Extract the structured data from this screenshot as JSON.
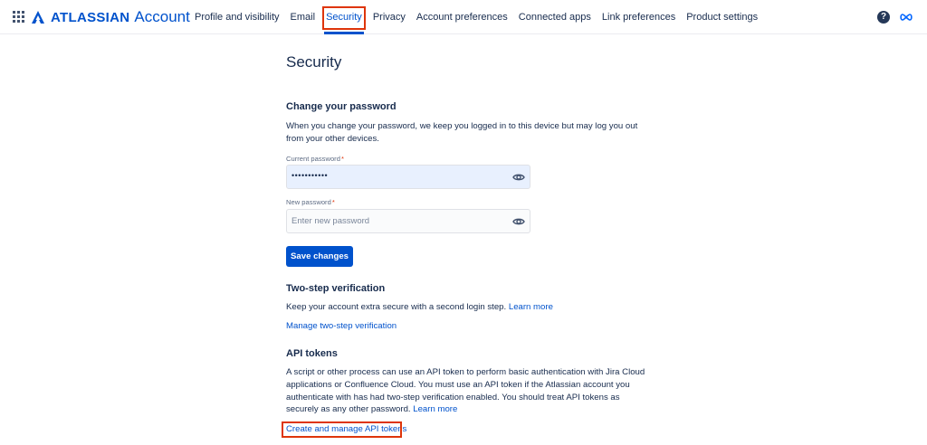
{
  "header": {
    "brand": "ATLASSIAN",
    "product": "Account",
    "nav": [
      {
        "label": "Profile and visibility"
      },
      {
        "label": "Email"
      },
      {
        "label": "Security",
        "active": true
      },
      {
        "label": "Privacy"
      },
      {
        "label": "Account preferences"
      },
      {
        "label": "Connected apps"
      },
      {
        "label": "Link preferences"
      },
      {
        "label": "Product settings"
      }
    ],
    "help_glyph": "?",
    "icons": [
      "app-switcher-icon",
      "atlassian-logo-icon",
      "help-icon",
      "infinity-icon"
    ]
  },
  "page": {
    "title": "Security",
    "password": {
      "heading": "Change your password",
      "description": "When you change your password, we keep you logged in to this device but may log you out from your other devices.",
      "current_label": "Current password",
      "current_value": "•••••••••••",
      "new_label": "New password",
      "new_placeholder": "Enter new password",
      "required_mark": "*",
      "save_label": "Save changes"
    },
    "two_step": {
      "heading": "Two-step verification",
      "description": "Keep your account extra secure with a second login step.",
      "learn_more": "Learn more",
      "manage_link": "Manage two-step verification"
    },
    "api_tokens": {
      "heading": "API tokens",
      "description": "A script or other process can use an API token to perform basic authentication with Jira Cloud applications or Confluence Cloud. You must use an API token if the Atlassian account you authenticate with has had two-step verification enabled. You should treat API tokens as securely as any other password.",
      "learn_more": "Learn more",
      "manage_link": "Create and manage API tokens"
    }
  },
  "colors": {
    "brand": "#0052cc",
    "text": "#172b4d",
    "highlight": "#de350b",
    "filled_field": "#e8f0fe"
  }
}
